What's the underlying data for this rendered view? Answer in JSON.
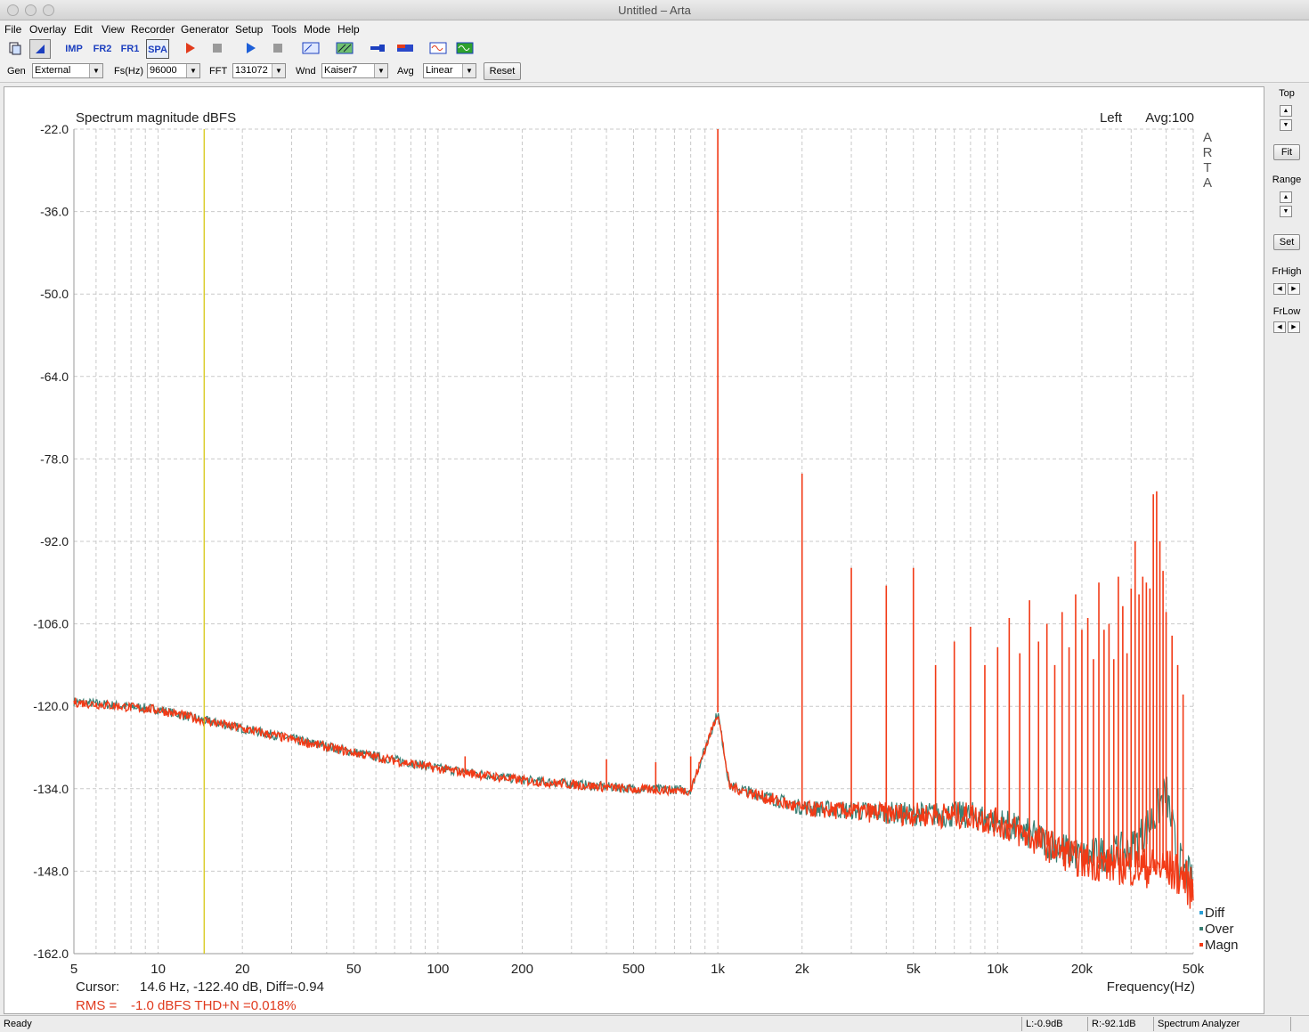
{
  "window": {
    "title": "Untitled – Arta"
  },
  "menu": [
    "File",
    "Overlay",
    "Edit",
    "View",
    "Recorder",
    "Generator",
    "Setup",
    "Tools",
    "Mode",
    "Help"
  ],
  "toolbar": {
    "imp_label": "IMP",
    "fr2_label": "FR2",
    "fr1_label": "FR1",
    "spa_label": "SPA"
  },
  "options": {
    "gen_label": "Gen",
    "gen_value": "External",
    "fs_label": "Fs(Hz)",
    "fs_value": "96000",
    "fft_label": "FFT",
    "fft_value": "131072",
    "wnd_label": "Wnd",
    "wnd_value": "Kaiser7",
    "avg_label": "Avg",
    "avg_value": "Linear",
    "reset_label": "Reset"
  },
  "side": {
    "top_label": "Top",
    "fit_label": "Fit",
    "range_label": "Range",
    "set_label": "Set",
    "frhigh_label": "FrHigh",
    "frlow_label": "FrLow"
  },
  "chart_data": {
    "type": "line",
    "title": "Spectrum magnitude dBFS",
    "channel_label": "Left",
    "avg_label": "Avg:100",
    "watermark": [
      "A",
      "R",
      "T",
      "A"
    ],
    "xlabel": "Frequency(Hz)",
    "x_scale": "log",
    "xlim": [
      5,
      50000
    ],
    "ylim": [
      -162,
      -22
    ],
    "yticks": [
      -22.0,
      -36.0,
      -50.0,
      -64.0,
      -78.0,
      -92.0,
      -106.0,
      -120.0,
      -134.0,
      -148.0,
      -162.0
    ],
    "ytick_labels": [
      "-22.0",
      "-36.0",
      "-50.0",
      "-64.0",
      "-78.0",
      "-92.0",
      "-106.0",
      "-120.0",
      "-134.0",
      "-148.0",
      "-162.0"
    ],
    "xticks": [
      5,
      10,
      20,
      50,
      100,
      200,
      500,
      1000,
      2000,
      5000,
      10000,
      20000,
      50000
    ],
    "xtick_labels": [
      "5",
      "10",
      "20",
      "50",
      "100",
      "200",
      "500",
      "1k",
      "2k",
      "5k",
      "10k",
      "20k",
      "50k"
    ],
    "grid": true,
    "legend_position": "bottom-right",
    "legend": [
      {
        "name": "Diff",
        "color": "#2a9fd6"
      },
      {
        "name": "Over",
        "color": "#3a7f73"
      },
      {
        "name": "Magn",
        "color": "#f23a16"
      }
    ],
    "cursor_freq": 14.6,
    "cursor_color": "#d4c200",
    "series": [
      {
        "name": "Over",
        "color": "#3a7f73",
        "noise_floor": [
          [
            5,
            -119.2
          ],
          [
            10,
            -120.5
          ],
          [
            14.6,
            -122.4
          ],
          [
            30,
            -125.5
          ],
          [
            50,
            -127.8
          ],
          [
            100,
            -130.5
          ],
          [
            200,
            -132.5
          ],
          [
            500,
            -134.0
          ],
          [
            800,
            -134.2
          ],
          [
            1000,
            -121.0
          ],
          [
            1100,
            -133.5
          ],
          [
            2000,
            -137.2
          ],
          [
            5000,
            -138.3
          ],
          [
            8000,
            -138.5
          ],
          [
            10000,
            -139.5
          ],
          [
            15000,
            -143.0
          ],
          [
            20000,
            -145.5
          ],
          [
            30000,
            -144.5
          ],
          [
            36000,
            -139.0
          ],
          [
            40000,
            -134.5
          ],
          [
            44000,
            -146.0
          ],
          [
            48000,
            -149.0
          ],
          [
            50000,
            -151.0
          ]
        ]
      },
      {
        "name": "Magn",
        "color": "#f23a16",
        "noise_floor": [
          [
            5,
            -119.3
          ],
          [
            10,
            -120.6
          ],
          [
            14.6,
            -122.4
          ],
          [
            30,
            -125.6
          ],
          [
            50,
            -127.9
          ],
          [
            100,
            -130.6
          ],
          [
            200,
            -132.6
          ],
          [
            500,
            -134.1
          ],
          [
            800,
            -134.3
          ],
          [
            1000,
            -121.0
          ],
          [
            1100,
            -133.6
          ],
          [
            2000,
            -137.4
          ],
          [
            5000,
            -138.4
          ],
          [
            8000,
            -138.6
          ],
          [
            10000,
            -139.8
          ],
          [
            15000,
            -143.5
          ],
          [
            20000,
            -146.3
          ],
          [
            30000,
            -147.3
          ],
          [
            40000,
            -147.6
          ],
          [
            46000,
            -149.0
          ],
          [
            50000,
            -151.5
          ]
        ],
        "peaks": [
          [
            125,
            -128.5
          ],
          [
            400,
            -129
          ],
          [
            600,
            -129.5
          ],
          [
            800,
            -128.5
          ],
          [
            900,
            -128
          ],
          [
            1000,
            -22
          ],
          [
            2000,
            -80.5
          ],
          [
            3000,
            -96.5
          ],
          [
            4000,
            -99.5
          ],
          [
            5000,
            -96.5
          ],
          [
            6000,
            -113
          ],
          [
            7000,
            -109
          ],
          [
            8000,
            -106.5
          ],
          [
            9000,
            -113
          ],
          [
            10000,
            -110
          ],
          [
            11000,
            -105
          ],
          [
            12000,
            -111
          ],
          [
            13000,
            -102
          ],
          [
            14000,
            -109
          ],
          [
            15000,
            -106
          ],
          [
            16000,
            -113
          ],
          [
            17000,
            -104
          ],
          [
            18000,
            -110
          ],
          [
            19000,
            -101
          ],
          [
            20000,
            -107
          ],
          [
            21000,
            -105
          ],
          [
            22000,
            -112
          ],
          [
            23000,
            -99
          ],
          [
            24000,
            -107
          ],
          [
            25000,
            -106
          ],
          [
            26000,
            -112
          ],
          [
            27000,
            -98
          ],
          [
            28000,
            -103
          ],
          [
            29000,
            -111
          ],
          [
            30000,
            -100
          ],
          [
            31000,
            -92
          ],
          [
            32000,
            -101
          ],
          [
            33000,
            -98
          ],
          [
            34000,
            -99
          ],
          [
            35000,
            -100
          ],
          [
            36000,
            -84
          ],
          [
            37000,
            -83.5
          ],
          [
            38000,
            -92
          ],
          [
            39000,
            -97
          ],
          [
            40000,
            -104
          ],
          [
            42000,
            -108
          ],
          [
            44000,
            -113
          ],
          [
            46000,
            -118
          ]
        ]
      }
    ]
  },
  "readout": {
    "cursor_label": "Cursor:",
    "cursor_text": "14.6 Hz, -122.40 dB,  Diff=-0.94",
    "rms_label": "RMS =",
    "rms_text": "-1.0 dBFS   THD+N =0.018%"
  },
  "status": {
    "ready": "Ready",
    "left_level": "L:-0.9dB",
    "right_level": "R:-92.1dB",
    "mode": "Spectrum Analyzer"
  }
}
